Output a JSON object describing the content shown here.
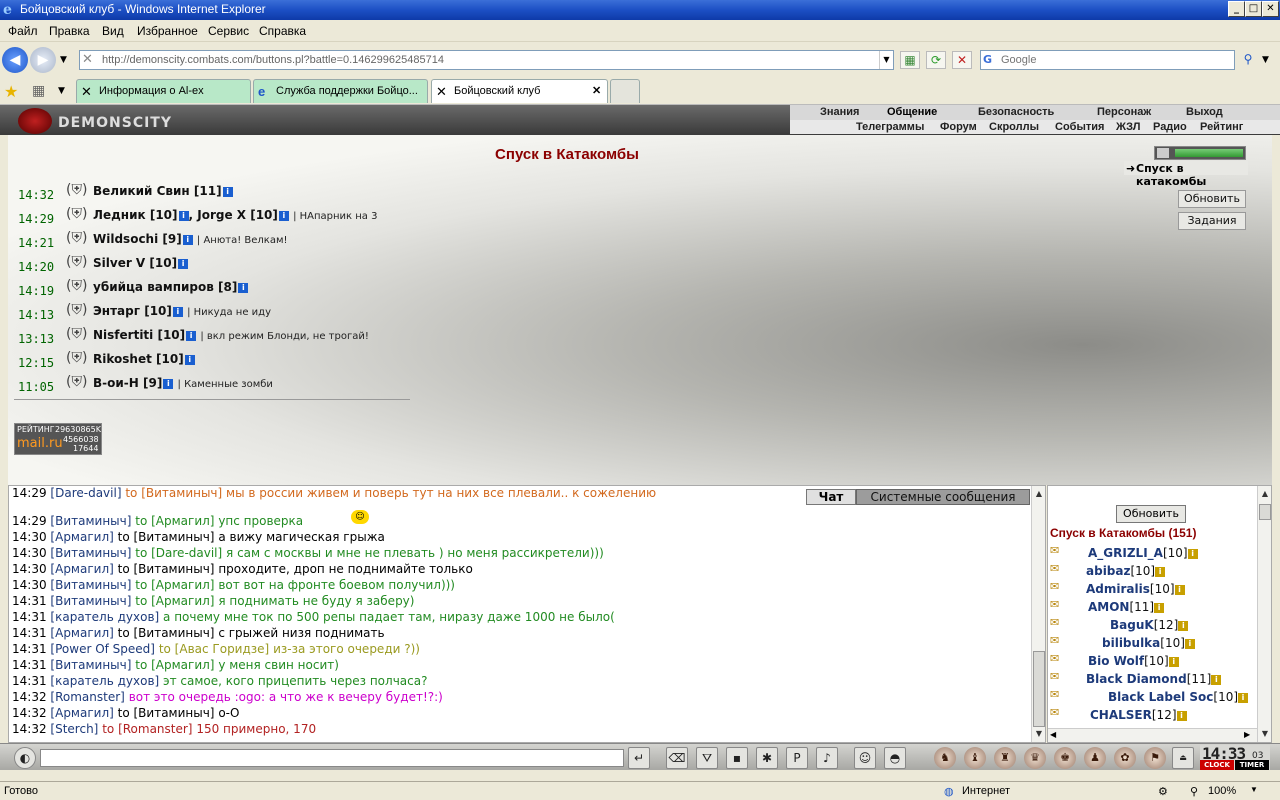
{
  "window": {
    "title": "Бойцовский клуб - Windows Internet Explorer",
    "minimize": "_",
    "maximize": "□",
    "close": "✕"
  },
  "menu": [
    "Файл",
    "Правка",
    "Вид",
    "Избранное",
    "Сервис",
    "Справка"
  ],
  "address": {
    "url": "http://demonscity.combats.com/buttons.pl?battle=0.146299625485714",
    "search_placeholder": "Google"
  },
  "tabs": [
    {
      "label": "Информация о Al-ex",
      "icon": "✕"
    },
    {
      "label": "Служба поддержки Бойцо...",
      "icon": "e"
    },
    {
      "label": "Бойцовский клуб",
      "icon": "✕",
      "close": "✕"
    }
  ],
  "game": {
    "logo_text": "DEMONSCITY",
    "nav_top": [
      "Знания",
      "Общение",
      "Безопасность",
      "Персонаж",
      "Выход"
    ],
    "nav_sub": [
      "Телеграммы",
      "Форум",
      "Скроллы",
      "События",
      "ЖЗЛ",
      "Радио",
      "Рейтинг"
    ],
    "title": "Спуск в Катакомбы",
    "location_link": "Спуск в катакомбы",
    "refresh_button": "Обновить",
    "tasks_button": "Задания",
    "rating": {
      "label": "РЕЙТИНГ",
      "v1": "29630865K",
      "brand": "mail.ru",
      "v2": "4566038",
      "v3": "17644"
    }
  },
  "log": [
    {
      "time": "14:32",
      "names": "Великий Свин",
      "level": "[11]",
      "note": ""
    },
    {
      "time": "14:29",
      "names": "Ледник",
      "level": "[10]",
      "names2": ", Jorge X",
      "level2": "[10]",
      "note": "| НАпарник на 3"
    },
    {
      "time": "14:21",
      "names": "Wildsochi",
      "level": "[9]",
      "note": "| Анюта! Велкам!"
    },
    {
      "time": "14:20",
      "names": "Silver V",
      "level": "[10]",
      "note": ""
    },
    {
      "time": "14:19",
      "names": "убийца вампиров",
      "level": "[8]",
      "note": ""
    },
    {
      "time": "14:13",
      "names": "Энтарг",
      "level": "[10]",
      "note": "| Никуда не иду"
    },
    {
      "time": "13:13",
      "names": "Nisfertiti",
      "level": "[10]",
      "note": "| вкл режим Блонди, не трогай!"
    },
    {
      "time": "12:15",
      "names": "Rikoshet",
      "level": "[10]",
      "note": ""
    },
    {
      "time": "11:05",
      "names": "В-ои-Н",
      "level": "[9]",
      "note": "| Каменные зомби"
    }
  ],
  "chat_tabs": {
    "chat": "Чат",
    "system": "Системные сообщения"
  },
  "chat": [
    {
      "time": "14:29",
      "from": "[Dare-davil]",
      "to": "to [Витаминыч]",
      "text": "мы в россии живем и поверь тут на них все плевали.. к сожелению",
      "color": "#d2691e"
    },
    {
      "time": "14:29",
      "from": "[Витаминыч]",
      "to": "to [Армагил]",
      "text": "упс проверка",
      "color": "#228b22"
    },
    {
      "time": "14:30",
      "from": "[Армагил]",
      "to": "to [Витаминыч]",
      "text": "а вижу магическая грыжа",
      "color": "#000000"
    },
    {
      "time": "14:30",
      "from": "[Витаминыч]",
      "to": "to [Dare-davil]",
      "text": "я сам с москвы и мне не плевать ) но меня рассикретели)))",
      "color": "#228b22"
    },
    {
      "time": "14:30",
      "from": "[Армагил]",
      "to": "to [Витаминыч]",
      "text": "проходите, дроп не поднимайте только",
      "color": "#000000"
    },
    {
      "time": "14:30",
      "from": "[Витаминыч]",
      "to": "to [Армагил]",
      "text": "вот вот на фронте боевом получил)))",
      "color": "#228b22"
    },
    {
      "time": "14:31",
      "from": "[Витаминыч]",
      "to": "to [Армагил]",
      "text": "я поднимать не буду я заберу)",
      "color": "#228b22"
    },
    {
      "time": "14:31",
      "from": "[каратель духов]",
      "to": "",
      "text": "а почему мне ток по 500 репы падает там, ниразу даже 1000 не было(",
      "color": "#228b22"
    },
    {
      "time": "14:31",
      "from": "[Армагил]",
      "to": "to [Витаминыч]",
      "text": "с грыжей низя поднимать",
      "color": "#000000"
    },
    {
      "time": "14:31",
      "from": "[Power Of Speed]",
      "to": "to [Авас Горидзе]",
      "text": "из-за этого очереди ?))",
      "color": "#9a9a20"
    },
    {
      "time": "14:31",
      "from": "[Витаминыч]",
      "to": "to [Армагил]",
      "text": "у меня свин носит)",
      "color": "#228b22"
    },
    {
      "time": "14:31",
      "from": "[каратель духов]",
      "to": "",
      "text": "эт самое, кого прицепить через полчаса?",
      "color": "#228b22"
    },
    {
      "time": "14:32",
      "from": "[Romanster]",
      "to": "",
      "text": "вот это очередь :ogo: а что же к вечеру будет!?:)",
      "color": "#cc00cc"
    },
    {
      "time": "14:32",
      "from": "[Армагил]",
      "to": "to [Витаминыч]",
      "text": "о-О",
      "color": "#000000"
    },
    {
      "time": "14:32",
      "from": "[Sterch]",
      "to": "to [Romanster]",
      "text": "150 примерно, 170",
      "color": "#b22222"
    }
  ],
  "users": {
    "refresh": "Обновить",
    "room": "Спуск в Катакомбы (151)",
    "list": [
      {
        "name": "A_GRIZLI_A",
        "level": "[10]"
      },
      {
        "name": "abibaz",
        "level": "[10]"
      },
      {
        "name": "Admiralis",
        "level": "[10]"
      },
      {
        "name": "AMON",
        "level": "[11]"
      },
      {
        "name": "BaguK",
        "level": "[12]"
      },
      {
        "name": "bilibulka",
        "level": "[10]"
      },
      {
        "name": "Bio Wolf",
        "level": "[10]"
      },
      {
        "name": "Black Diamond",
        "level": "[11]"
      },
      {
        "name": "Black Label Soc",
        "level": "[10]"
      },
      {
        "name": "CHALSER",
        "level": "[12]"
      }
    ]
  },
  "clock": {
    "time": "14:33",
    "seconds": "03",
    "clock_label": "CLOCK",
    "timer_label": "TIMER"
  },
  "status": {
    "left": "Готово",
    "zone": "Интернет",
    "zoom": "100%"
  },
  "colors": {
    "chat_name": "#1d3a7a",
    "log_time": "#006400",
    "title": "#8b0000"
  }
}
